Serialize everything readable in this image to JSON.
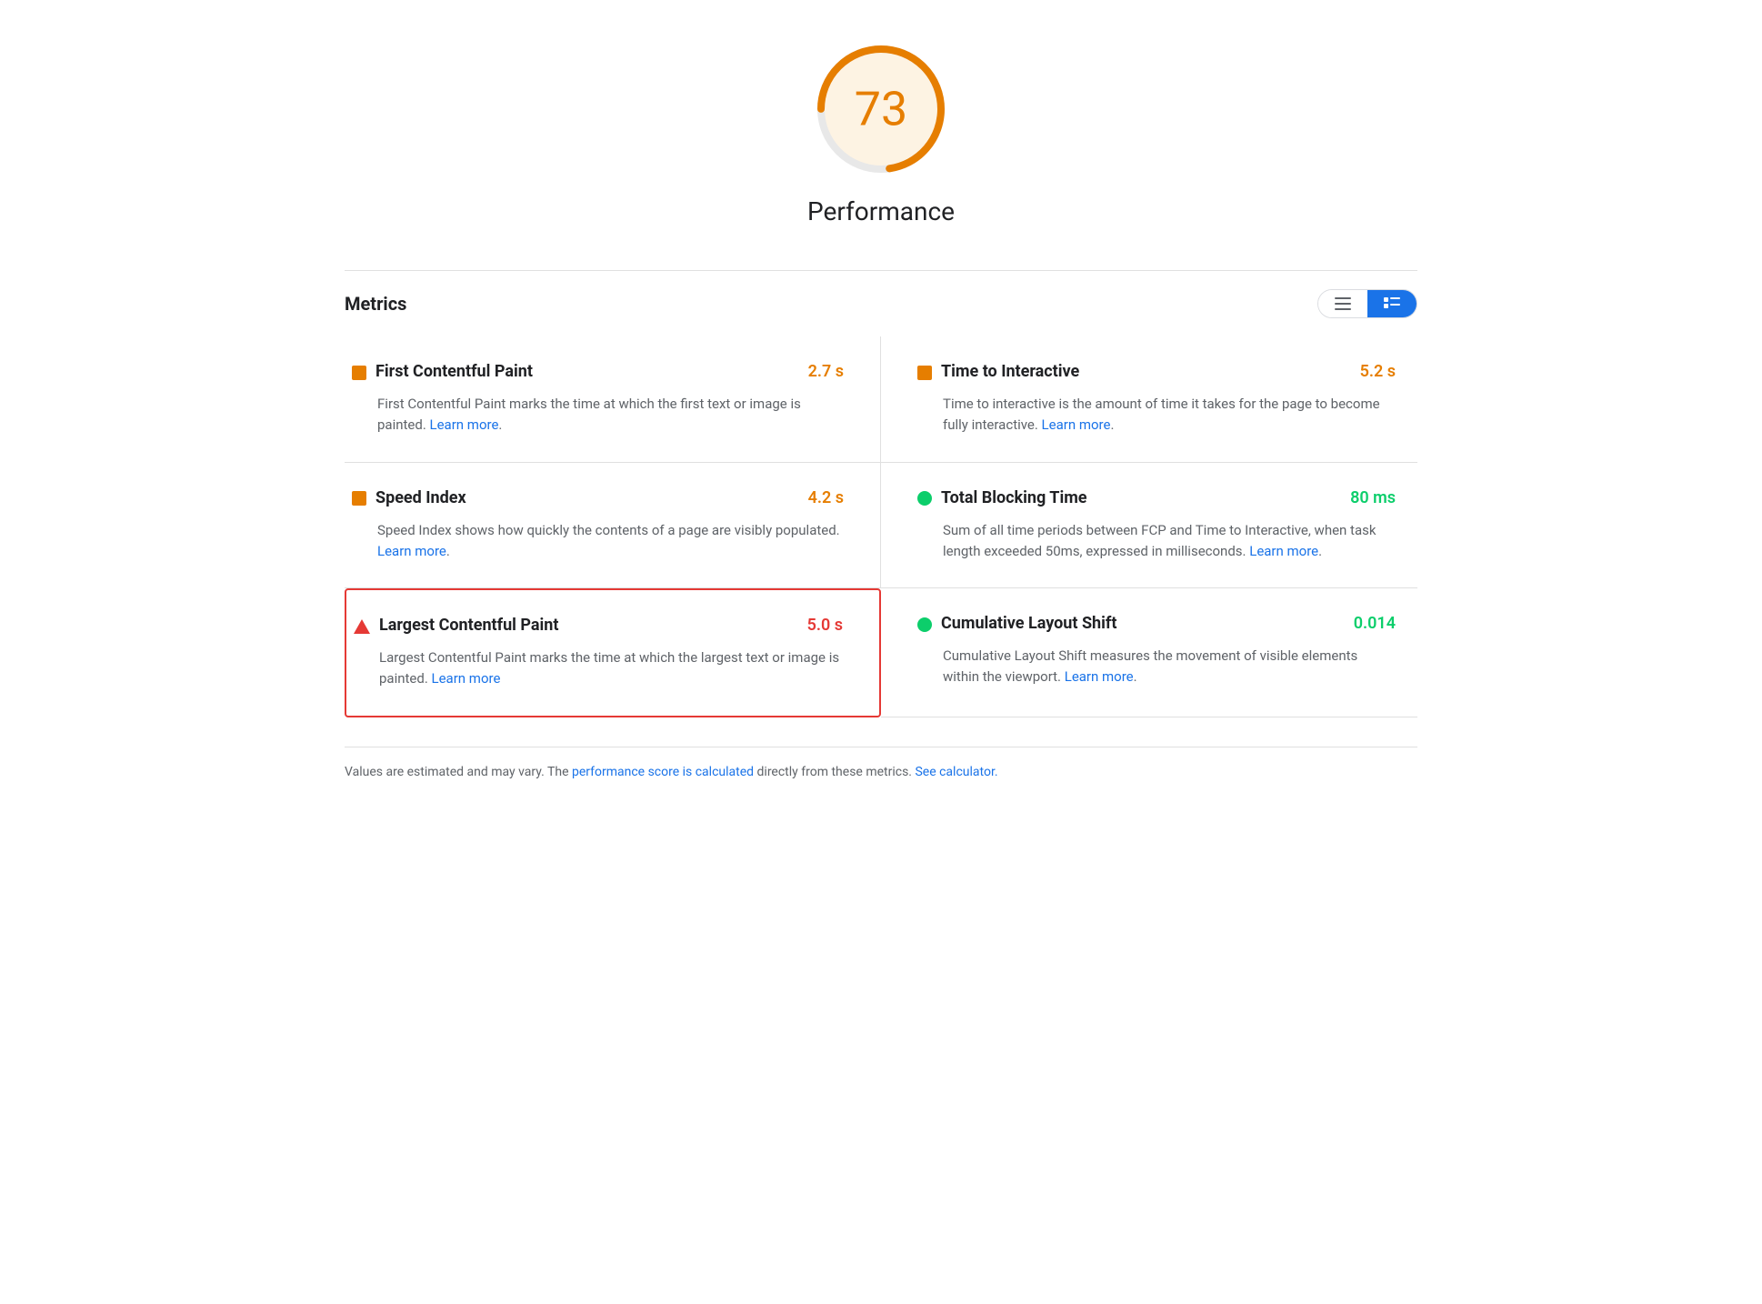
{
  "score": {
    "value": "73",
    "label": "Performance",
    "color": "#e67e00",
    "bg_color": "#fdf3e3"
  },
  "metrics_section": {
    "title": "Metrics",
    "view_list_icon": "≡",
    "view_detail_icon": "≡"
  },
  "metrics": [
    {
      "id": "fcp",
      "icon_type": "square",
      "icon_color": "#e67e00",
      "name": "First Contentful Paint",
      "value": "2.7 s",
      "value_color": "orange",
      "description": "First Contentful Paint marks the time at which the first text or image is painted.",
      "learn_more_label": "Learn more",
      "learn_more_href": "#",
      "highlighted": false,
      "side": "left"
    },
    {
      "id": "tti",
      "icon_type": "square",
      "icon_color": "#e67e00",
      "name": "Time to Interactive",
      "value": "5.2 s",
      "value_color": "orange",
      "description": "Time to interactive is the amount of time it takes for the page to become fully interactive.",
      "learn_more_label": "Learn more",
      "learn_more_href": "#",
      "highlighted": false,
      "side": "right"
    },
    {
      "id": "si",
      "icon_type": "square",
      "icon_color": "#e67e00",
      "name": "Speed Index",
      "value": "4.2 s",
      "value_color": "orange",
      "description": "Speed Index shows how quickly the contents of a page are visibly populated.",
      "learn_more_label": "Learn more",
      "learn_more_href": "#",
      "highlighted": false,
      "side": "left"
    },
    {
      "id": "tbt",
      "icon_type": "circle",
      "icon_color": "#0cce6b",
      "name": "Total Blocking Time",
      "value": "80 ms",
      "value_color": "green",
      "description": "Sum of all time periods between FCP and Time to Interactive, when task length exceeded 50ms, expressed in milliseconds.",
      "learn_more_label": "Learn more",
      "learn_more_href": "#",
      "highlighted": false,
      "side": "right"
    },
    {
      "id": "lcp",
      "icon_type": "triangle",
      "icon_color": "#e53935",
      "name": "Largest Contentful Paint",
      "value": "5.0 s",
      "value_color": "red",
      "description": "Largest Contentful Paint marks the time at which the largest text or image is painted.",
      "learn_more_label": "Learn more",
      "learn_more_href": "#",
      "highlighted": true,
      "side": "left"
    },
    {
      "id": "cls",
      "icon_type": "circle",
      "icon_color": "#0cce6b",
      "name": "Cumulative Layout Shift",
      "value": "0.014",
      "value_color": "green",
      "description": "Cumulative Layout Shift measures the movement of visible elements within the viewport.",
      "learn_more_label": "Learn more",
      "learn_more_href": "#",
      "highlighted": false,
      "side": "right"
    }
  ],
  "footer": {
    "text_before": "Values are estimated and may vary. The ",
    "link1_label": "performance score is calculated",
    "link1_href": "#",
    "text_after": " directly from these metrics. ",
    "link2_label": "See calculator.",
    "link2_href": "#"
  }
}
